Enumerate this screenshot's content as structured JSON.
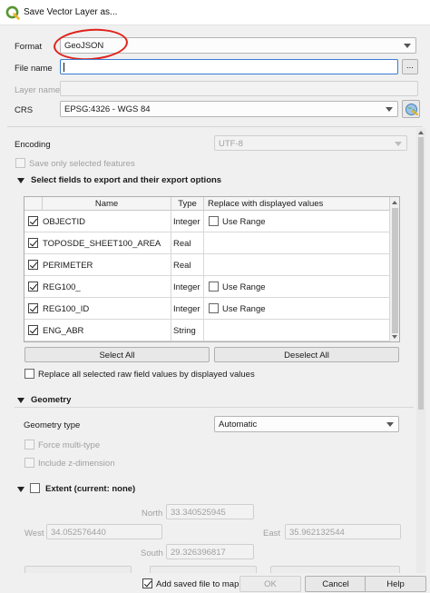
{
  "window": {
    "title": "Save Vector Layer as..."
  },
  "format": {
    "label": "Format",
    "value": "GeoJSON"
  },
  "file_name": {
    "label": "File name",
    "value": "",
    "browse_label": "..."
  },
  "layer_name": {
    "label": "Layer name",
    "value": ""
  },
  "crs": {
    "label": "CRS",
    "value": "EPSG:4326 - WGS 84"
  },
  "encoding": {
    "label": "Encoding",
    "value": "UTF-8"
  },
  "save_selected": {
    "label": "Save only selected features",
    "checked": false
  },
  "fields_section": {
    "title": "Select fields to export and their export options",
    "columns": [
      "Name",
      "Type",
      "Replace with displayed values"
    ],
    "rows": [
      {
        "name": "OBJECTID",
        "type": "Integer",
        "checked": true,
        "replace": "Use Range"
      },
      {
        "name": "TOPOSDE_SHEET100_AREA",
        "type": "Real",
        "checked": true,
        "replace": ""
      },
      {
        "name": "PERIMETER",
        "type": "Real",
        "checked": true,
        "replace": ""
      },
      {
        "name": "REG100_",
        "type": "Integer",
        "checked": true,
        "replace": "Use Range"
      },
      {
        "name": "REG100_ID",
        "type": "Integer",
        "checked": true,
        "replace": "Use Range"
      },
      {
        "name": "ENG_ABR",
        "type": "String",
        "checked": true,
        "replace": ""
      }
    ],
    "select_all_label": "Select All",
    "deselect_all_label": "Deselect All",
    "replace_all_label": "Replace all selected raw field values by displayed values"
  },
  "geometry_section": {
    "title": "Geometry",
    "type_label": "Geometry type",
    "type_value": "Automatic",
    "force_multi_label": "Force multi-type",
    "include_z_label": "Include z-dimension"
  },
  "extent_section": {
    "title": "Extent (current: none)",
    "north_label": "North",
    "north_value": "33.340525945",
    "west_label": "West",
    "west_value": "34.052576440",
    "east_label": "East",
    "east_value": "35.962132544",
    "south_label": "South",
    "south_value": "29.326396817"
  },
  "footer": {
    "add_saved_label": "Add saved file to map",
    "add_saved_checked": true,
    "ok_label": "OK",
    "cancel_label": "Cancel",
    "help_label": "Help"
  },
  "colors": {
    "annotation": "#e0221b",
    "focus": "#3a7bd5",
    "qgis_green": "#589632"
  }
}
